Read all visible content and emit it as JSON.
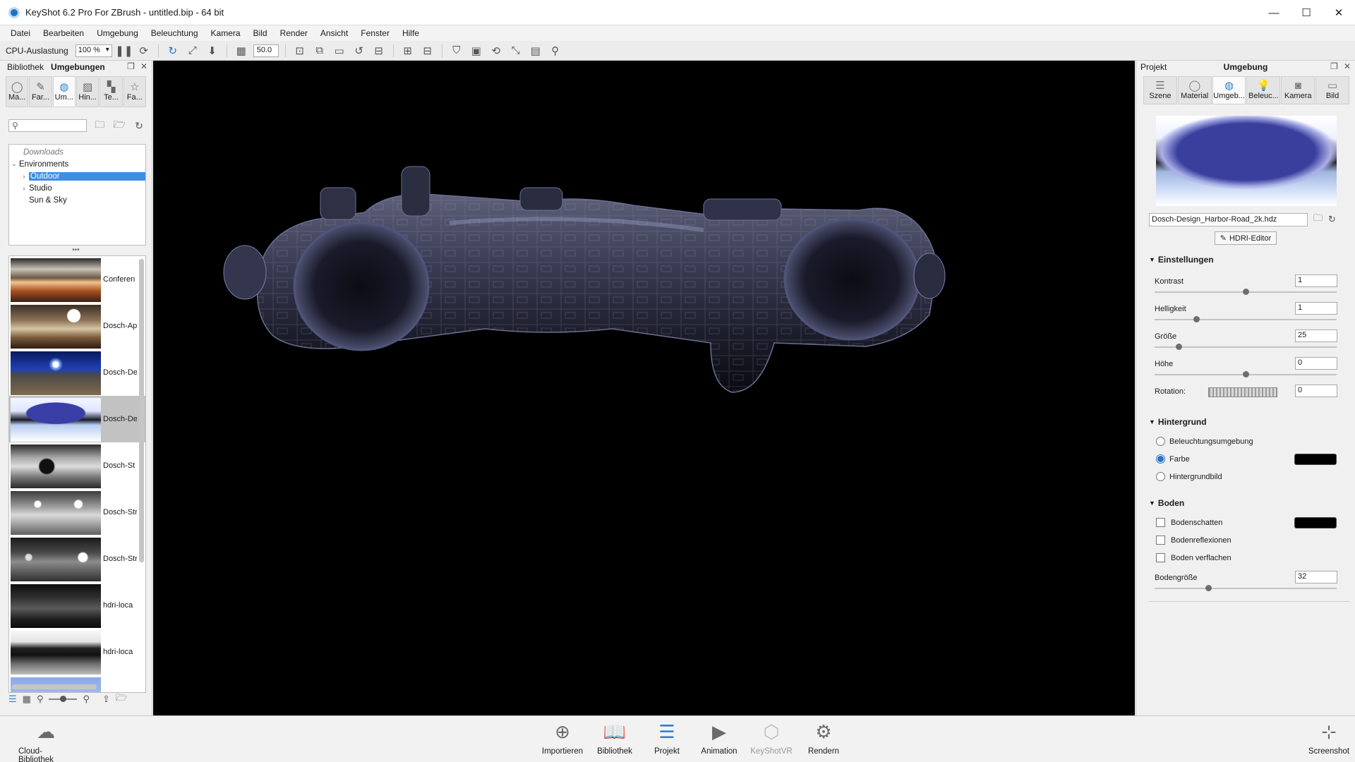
{
  "window": {
    "title": "KeyShot 6.2 Pro For ZBrush - untitled.bip  - 64 bit",
    "controls": {
      "minimize": "—",
      "maximize": "☐",
      "close": "✕"
    }
  },
  "menu": [
    "Datei",
    "Bearbeiten",
    "Umgebung",
    "Beleuchtung",
    "Kamera",
    "Bild",
    "Render",
    "Ansicht",
    "Fenster",
    "Hilfe"
  ],
  "toolbar": {
    "cpu_label": "CPU-Auslastung",
    "cpu_value": "100 %",
    "focal_value": "50.0"
  },
  "library": {
    "header_left": "Bibliothek",
    "header_active": "Umgebungen",
    "tabs": [
      {
        "label": "Ma...",
        "icon": "material-icon"
      },
      {
        "label": "Far...",
        "icon": "color-icon"
      },
      {
        "label": "Um...",
        "icon": "environment-icon"
      },
      {
        "label": "Hin...",
        "icon": "backplate-icon"
      },
      {
        "label": "Te...",
        "icon": "texture-icon"
      },
      {
        "label": "Fa...",
        "icon": "favorites-icon"
      }
    ],
    "search_placeholder": "",
    "tree": {
      "downloads": "Downloads",
      "environments": "Environments",
      "outdoor": "Outdoor",
      "studio": "Studio",
      "sun_sky": "Sun & Sky"
    },
    "thumbnails": [
      {
        "name": "Conferen",
        "style": "conference"
      },
      {
        "name": "Dosch-Ap",
        "style": "apartment"
      },
      {
        "name": "Dosch-De",
        "style": "desert-night"
      },
      {
        "name": "Dosch-De",
        "style": "harbor",
        "selected": true
      },
      {
        "name": "Dosch-St",
        "style": "studio1"
      },
      {
        "name": "Dosch-Str",
        "style": "studio2"
      },
      {
        "name": "Dosch-Str",
        "style": "studio3"
      },
      {
        "name": "hdri-loca",
        "style": "hall"
      },
      {
        "name": "hdri-loca",
        "style": "trees"
      }
    ]
  },
  "project": {
    "header_left": "Projekt",
    "header_center": "Umgebung",
    "tabs": [
      {
        "label": "Szene",
        "icon": "scene-icon"
      },
      {
        "label": "Material",
        "icon": "material-icon"
      },
      {
        "label": "Umgeb...",
        "icon": "environment-icon"
      },
      {
        "label": "Beleuc...",
        "icon": "lighting-icon"
      },
      {
        "label": "Kamera",
        "icon": "camera-icon"
      },
      {
        "label": "Bild",
        "icon": "image-icon"
      }
    ],
    "hdri_file": "Dosch-Design_Harbor-Road_2k.hdz",
    "hdri_editor_label": "HDRI-Editor",
    "settings_title": "Einstellungen",
    "settings": [
      {
        "label": "Kontrast",
        "value": "1",
        "slider": 0.5
      },
      {
        "label": "Helligkeit",
        "value": "1",
        "slider": 0.2
      },
      {
        "label": "Größe",
        "value": "25",
        "slider": 0.1
      },
      {
        "label": "Höhe",
        "value": "0",
        "slider": 0.5
      },
      {
        "label": "Rotation:",
        "value": "0"
      }
    ],
    "background_title": "Hintergrund",
    "background_options": [
      {
        "label": "Beleuchtungsumgebung",
        "selected": false
      },
      {
        "label": "Farbe",
        "selected": true
      },
      {
        "label": "Hintergrundbild",
        "selected": false
      }
    ],
    "background_color": "#000000",
    "ground_title": "Boden",
    "ground_options": [
      {
        "label": "Bodenschatten",
        "checked": false
      },
      {
        "label": "Bodenreflexionen",
        "checked": false
      },
      {
        "label": "Boden verflachen",
        "checked": false
      }
    ],
    "ground_shadow_color": "#000000",
    "ground_size_label": "Bodengröße",
    "ground_size_value": "32",
    "ground_size_slider": 0.28
  },
  "bottom": {
    "cloud_library": "Cloud-Bibliothek",
    "import": "Importieren",
    "library": "Bibliothek",
    "project": "Projekt",
    "animation": "Animation",
    "keyshotvr": "KeyShotVR",
    "render": "Rendern",
    "screenshot": "Screenshot"
  },
  "colors": {
    "accent": "#2f7fd0",
    "selection": "#3d8ee4",
    "viewport_bg": "#000000"
  }
}
